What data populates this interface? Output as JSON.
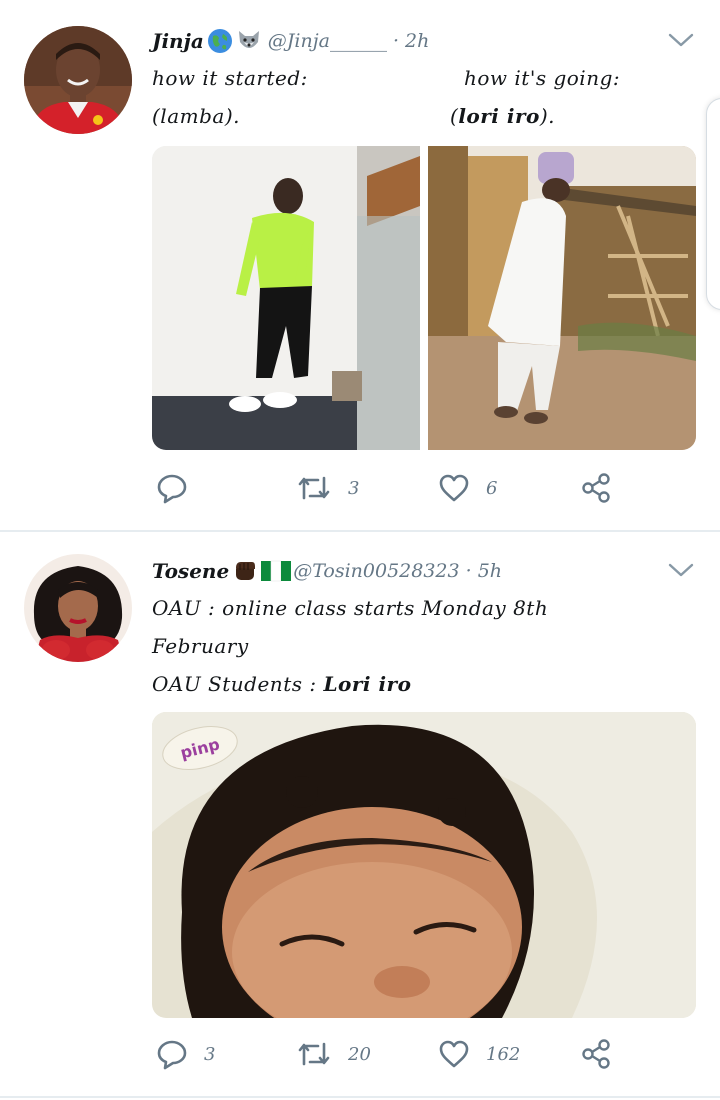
{
  "tweets": [
    {
      "name": "Jinja",
      "emojis": [
        "globe-icon",
        "wolf-face-icon"
      ],
      "handle": "@Jinja______",
      "time": "· 2h",
      "lines": [
        {
          "left": "how it started:",
          "right": "how it's going:"
        },
        {
          "left": "(lamba).",
          "right_prefix": "(",
          "right_bold": "lori iro",
          "right_suffix": ")."
        }
      ],
      "actions": {
        "reply": "",
        "retweet": "3",
        "like": "6"
      }
    },
    {
      "name": "Tosene",
      "emojis": [
        "raised-fist-icon",
        "nigeria-flag-icon"
      ],
      "handle": "@Tosin00528323",
      "time": "· 5h",
      "lines": [
        {
          "text": "OAU : online class starts Monday 8th"
        },
        {
          "text": "February"
        },
        {
          "prefix": "OAU Students : ",
          "bold": "Lori iro"
        }
      ],
      "actions": {
        "reply": "3",
        "retweet": "20",
        "like": "162"
      }
    }
  ],
  "media": {
    "tweet1_left_caption": "",
    "tweet2_sticker_text": "pinp"
  },
  "colors": {
    "text": "#14171a",
    "muted": "#657786",
    "divider": "#e6ecf0"
  }
}
